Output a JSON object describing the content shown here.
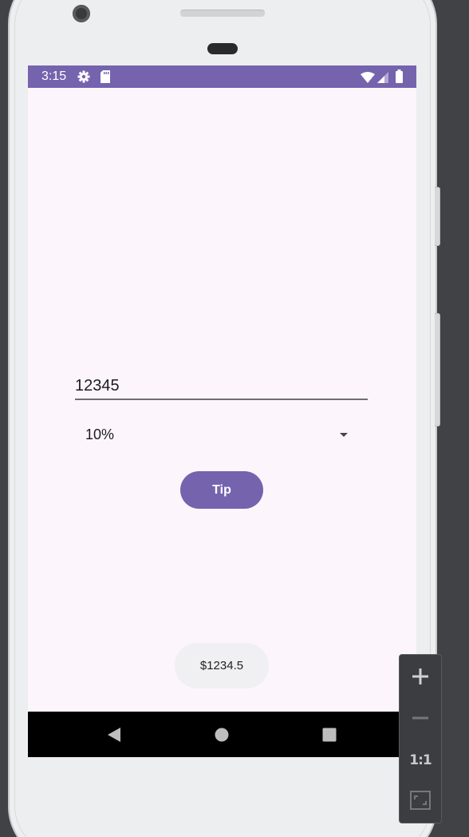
{
  "status_bar": {
    "time": "3:15",
    "icons": [
      "settings-icon",
      "sd-card-icon",
      "wifi-icon",
      "signal-icon",
      "battery-icon"
    ],
    "background_color": "#7563ae"
  },
  "form": {
    "amount_value": "12345",
    "amount_placeholder": "",
    "tip_percent_selected": "10%",
    "tip_button_label": "Tip"
  },
  "toast": {
    "message": "$1234.5"
  },
  "nav_bar": {
    "buttons": [
      "back-icon",
      "home-icon",
      "recents-icon"
    ]
  },
  "emulator_toolbar": {
    "zoom_in": "zoom-in-icon",
    "zoom_out": "zoom-out-icon",
    "actual_size_label": "1:1",
    "fit_screen": "fit-screen-icon"
  },
  "colors": {
    "accent": "#7563ae",
    "screen_background": "#fcf6fc",
    "toast_background": "#f0eff1"
  }
}
